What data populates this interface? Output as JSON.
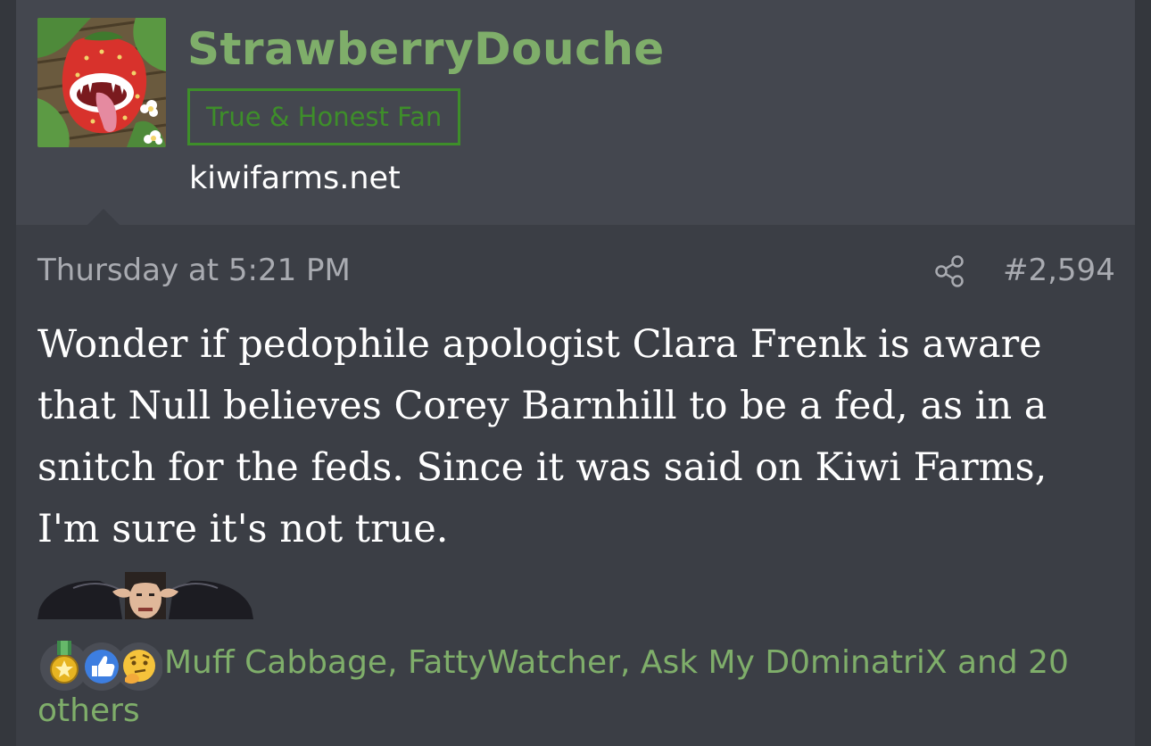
{
  "user": {
    "name": "StrawberryDouche",
    "title": "True & Honest Fan",
    "site": "kiwifarms.net",
    "avatar_icon": "strawberry-monster-avatar"
  },
  "post": {
    "date": "Thursday at 5:21 PM",
    "number": "#2,594",
    "share_icon": "share-icon",
    "body": "Wonder if pedophile apologist Clara Frenk is aware that Null believes Corey Barnhill to be a fed, as in a snitch for the feds. Since it was said on Kiwi Farms, I'm sure it's not true.",
    "emote_icon": "hands-on-head-emote"
  },
  "reactions": {
    "icons": [
      "medal-icon",
      "thumbs-up-icon",
      "thinking-face-icon"
    ],
    "users_line1": "Muff Cabbage, FattyWatcher, Ask My D0minatriX and 20",
    "users_line2": "others"
  },
  "colors": {
    "page_bg": "#3b3e45",
    "header_bg": "#44474f",
    "username": "#7fae6a",
    "title_border": "#3e8e2a",
    "meta_text": "#a9abb1",
    "body_text": "#ffffff"
  }
}
